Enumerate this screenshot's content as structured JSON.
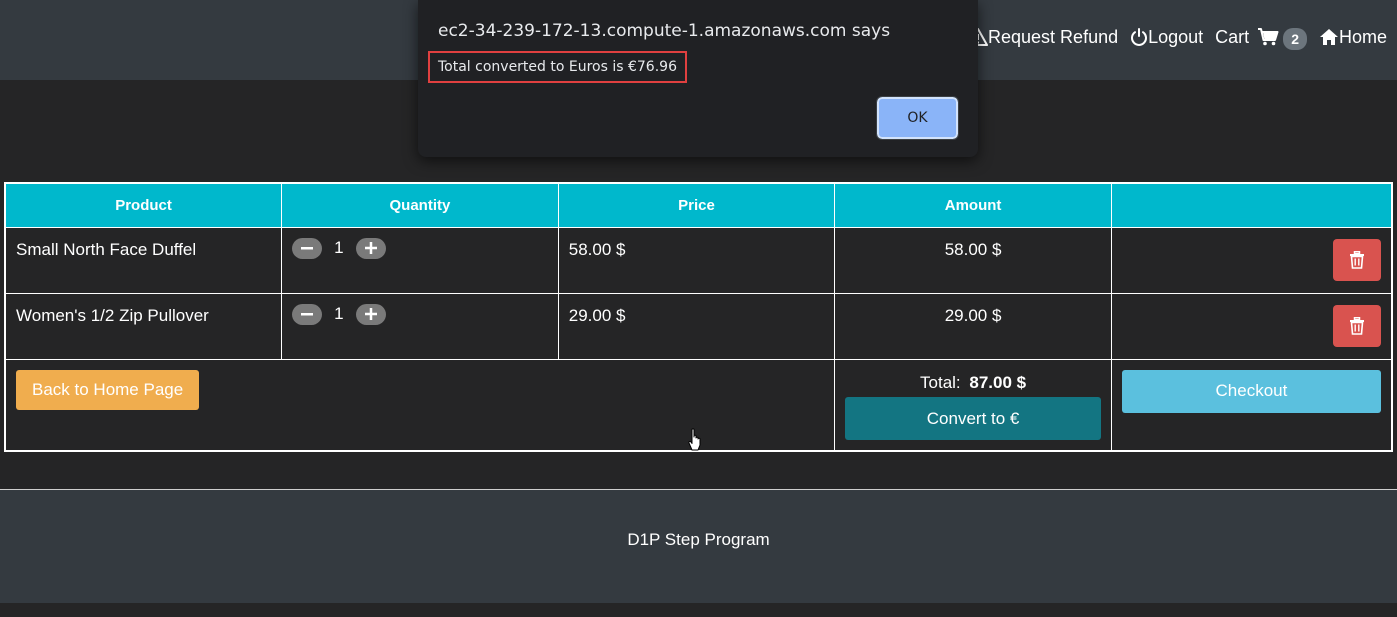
{
  "nav": {
    "request_refund": "Request Refund",
    "logout": "Logout",
    "cart": "Cart",
    "cart_count": "2",
    "home": "Home"
  },
  "table": {
    "headers": [
      "Product",
      "Quantity",
      "Price",
      "Amount",
      ""
    ],
    "rows": [
      {
        "product": "Small North Face Duffel",
        "quantity": "1",
        "price": "58.00 $",
        "amount": "58.00 $"
      },
      {
        "product": "Women's 1/2 Zip Pullover",
        "quantity": "1",
        "price": "29.00 $",
        "amount": "29.00 $"
      }
    ],
    "back_button": "Back to Home Page",
    "total_label": "Total:",
    "total_value": "87.00 $",
    "convert_button": "Convert to €",
    "checkout_button": "Checkout"
  },
  "footer": {
    "text": "D1P Step Program"
  },
  "dialog": {
    "title": "ec2-34-239-172-13.compute-1.amazonaws.com says",
    "message": "Total converted to Euros is €76.96",
    "ok_button": "OK"
  },
  "colors": {
    "header_bg": "#00b8cc",
    "delete_button": "#d9534f",
    "back_button": "#f0ad4e",
    "convert_button": "#137582",
    "checkout_button": "#5bc0de",
    "navbar_bg": "#343a40",
    "dialog_ok": "#8ab4f8"
  },
  "icons": [
    "warning-icon",
    "power-icon",
    "cart-icon",
    "home-icon",
    "minus-icon",
    "plus-icon",
    "trash-icon"
  ]
}
